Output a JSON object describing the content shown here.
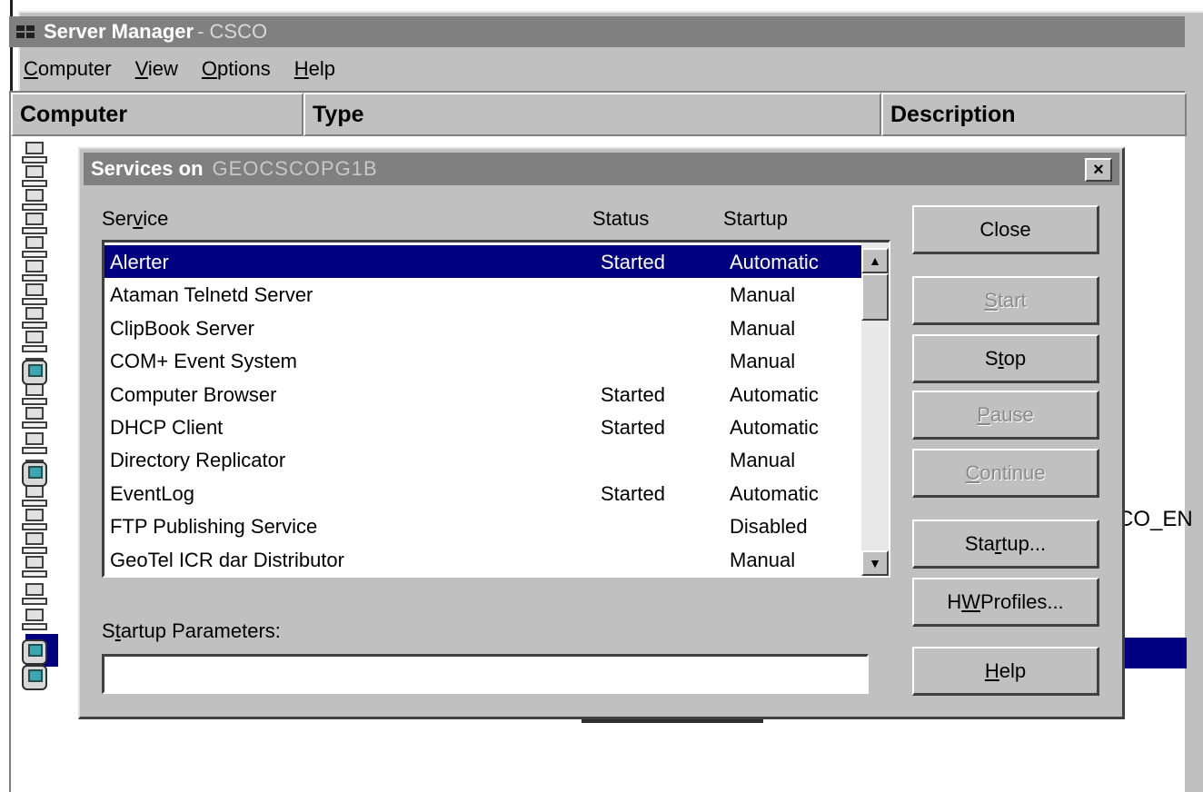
{
  "server_manager": {
    "title": "Server Manager",
    "title_suffix": "- CSCO",
    "menu": [
      {
        "label": "Computer"
      },
      {
        "label": "View"
      },
      {
        "label": "Options"
      },
      {
        "label": "Help"
      }
    ],
    "columns": {
      "computer": "Computer",
      "type": "Type",
      "description": "Description"
    },
    "partial_description_text": "CO_EN"
  },
  "dialog": {
    "title": "Services on",
    "host": "GEOCSCOPG1B",
    "close_glyph": "×",
    "columns": {
      "service": "Service",
      "status": "Status",
      "startup": "Startup"
    },
    "services": [
      {
        "name": "Alerter",
        "status": "Started",
        "startup": "Automatic",
        "selected": true
      },
      {
        "name": "Ataman Telnetd Server",
        "status": "",
        "startup": "Manual"
      },
      {
        "name": "ClipBook Server",
        "status": "",
        "startup": "Manual"
      },
      {
        "name": "COM+ Event System",
        "status": "",
        "startup": "Manual"
      },
      {
        "name": "Computer Browser",
        "status": "Started",
        "startup": "Automatic"
      },
      {
        "name": "DHCP Client",
        "status": "Started",
        "startup": "Automatic"
      },
      {
        "name": "Directory Replicator",
        "status": "",
        "startup": "Manual"
      },
      {
        "name": "EventLog",
        "status": "Started",
        "startup": "Automatic"
      },
      {
        "name": "FTP Publishing Service",
        "status": "",
        "startup": "Disabled"
      },
      {
        "name": "GeoTel ICR dar Distributor",
        "status": "",
        "startup": "Manual"
      }
    ],
    "startup_parameters_label": "Startup Parameters:",
    "startup_parameters_value": "",
    "buttons": {
      "close": "Close",
      "start": "Start",
      "stop": "Stop",
      "pause": "Pause",
      "continue": "Continue",
      "startup": "Startup...",
      "hw_profiles": "HW Profiles...",
      "help": "Help"
    },
    "scroll": {
      "up_glyph": "▲",
      "down_glyph": "▼"
    }
  }
}
